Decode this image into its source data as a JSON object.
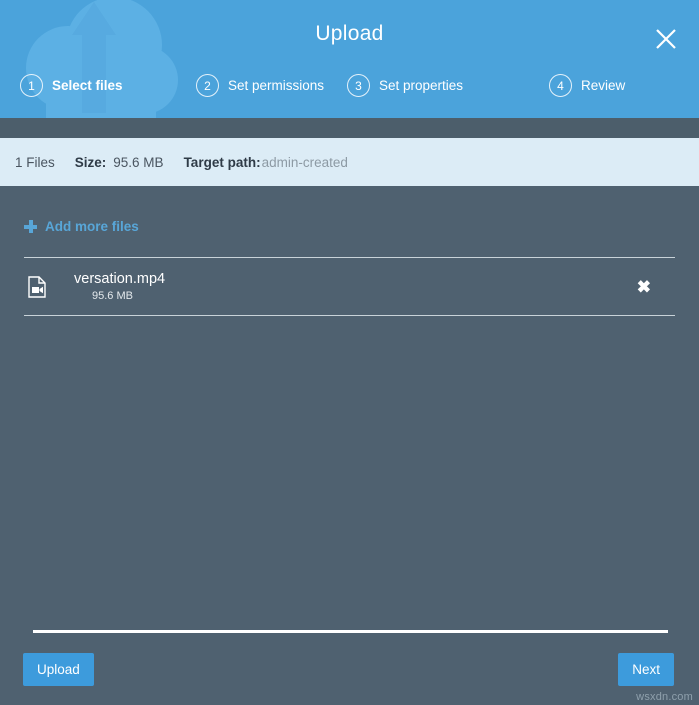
{
  "header": {
    "title": "Upload",
    "close_icon": "close-icon",
    "watermark_icon": "cloud-upload-icon",
    "steps": [
      {
        "number": "1",
        "label": "Select files",
        "active": true
      },
      {
        "number": "2",
        "label": "Set permissions",
        "active": false
      },
      {
        "number": "3",
        "label": "Set properties",
        "active": false
      },
      {
        "number": "4",
        "label": "Review",
        "active": false
      }
    ]
  },
  "info_bar": {
    "files_count": "1 Files",
    "size_label": "Size:",
    "size_value": "95.6 MB",
    "target_path_label": "Target path:",
    "target_path_value": "admin-created"
  },
  "main": {
    "add_more_label": "Add more files",
    "add_more_icon": "plus-icon",
    "files": [
      {
        "icon": "video-file-icon",
        "name": "versation.mp4",
        "size": "95.6 MB",
        "remove_icon": "close-icon"
      }
    ]
  },
  "footer": {
    "upload_label": "Upload",
    "next_label": "Next",
    "progress_percent": 0
  },
  "watermark": "wsxdn.com",
  "colors": {
    "header_blue": "#4ba3db",
    "body_bg": "#4f6170",
    "info_bar_bg": "#dcecf6",
    "button_blue": "#3d9bdc",
    "link_blue": "#58a6d8",
    "dark_band": "#4c5e6b"
  }
}
